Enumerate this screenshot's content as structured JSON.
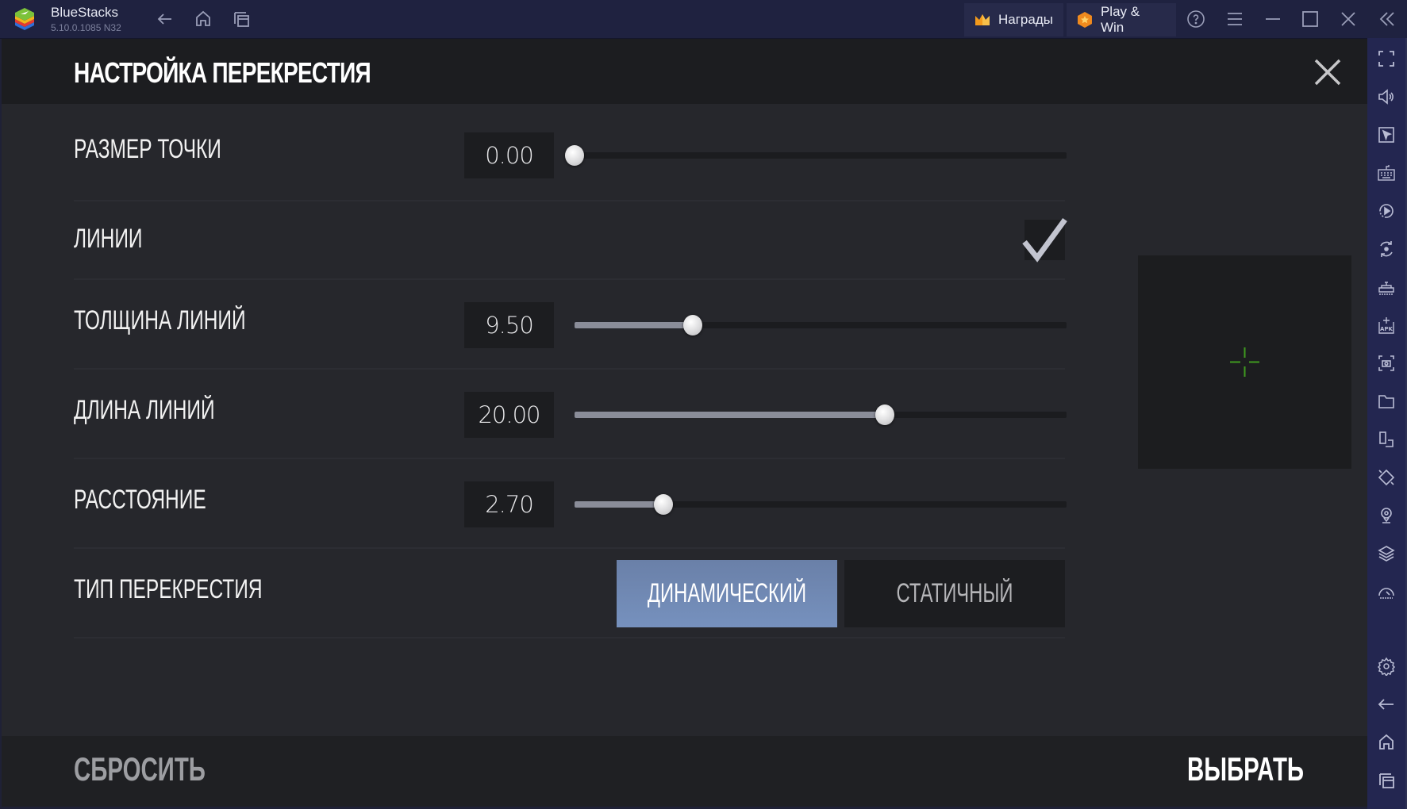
{
  "titlebar": {
    "app_name": "BlueStacks",
    "version": "5.10.0.1085  N32",
    "rewards_label": "Награды",
    "play_win_label": "Play & Win",
    "icons": [
      "back-icon",
      "home-icon",
      "multi-instance-icon",
      "help-icon",
      "menu-icon",
      "minimize-icon",
      "maximize-icon",
      "close-icon",
      "collapse-sidebar-icon"
    ]
  },
  "sidebar": {
    "items": [
      "fullscreen-icon",
      "volume-icon",
      "pointer-icon",
      "keyboard-icon",
      "macro-play-icon",
      "sync-icon",
      "game-controls-icon",
      "install-apk-icon",
      "screenshot-icon",
      "folder-icon",
      "multi-instance-icon",
      "rotate-icon",
      "location-icon",
      "layers-icon",
      "performance-icon",
      "settings-icon",
      "back-icon",
      "home-icon",
      "recent-apps-icon"
    ]
  },
  "panel": {
    "title": "НАСТРОЙКА ПЕРЕКРЕСТИЯ",
    "rows": {
      "dot_size": {
        "label": "РАЗМЕР ТОЧКИ",
        "value": "0.00",
        "fraction": 0.0
      },
      "lines": {
        "label": "ЛИНИИ",
        "checked": true
      },
      "line_thickness": {
        "label": "ТОЛЩИНА ЛИНИЙ",
        "value": "9.50",
        "fraction": 0.24
      },
      "line_length": {
        "label": "ДЛИНА ЛИНИЙ",
        "value": "20.00",
        "fraction": 0.63
      },
      "distance": {
        "label": "РАССТОЯНИЕ",
        "value": "2.70",
        "fraction": 0.18
      },
      "crosshair_type": {
        "label": "ТИП ПЕРЕКРЕСТИЯ",
        "options": [
          "ДИНАМИЧЕСКИЙ",
          "СТАТИЧНЫЙ"
        ],
        "selected": "ДИНАМИЧЕСКИЙ"
      }
    },
    "preview": {
      "crosshair_color": "#3f9a1f"
    },
    "footer": {
      "reset_label": "СБРОСИТЬ",
      "select_label": "ВЫБРАТЬ"
    }
  },
  "colors": {
    "accent": "#7088b6",
    "titlebar": "#1f2240",
    "sidebar": "#232650"
  }
}
